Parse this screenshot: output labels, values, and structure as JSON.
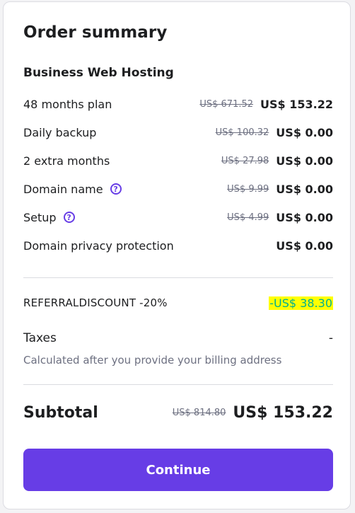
{
  "summary": {
    "title": "Order summary",
    "product": "Business Web Hosting",
    "items": [
      {
        "label": "48 months plan",
        "old_price": "US$ 671.52",
        "price": "US$ 153.22",
        "help": false
      },
      {
        "label": "Daily backup",
        "old_price": "US$ 100.32",
        "price": "US$ 0.00",
        "help": false
      },
      {
        "label": "2 extra months",
        "old_price": "US$ 27.98",
        "price": "US$ 0.00",
        "help": false
      },
      {
        "label": "Domain name",
        "old_price": "US$ 9.99",
        "price": "US$ 0.00",
        "help": true
      },
      {
        "label": "Setup",
        "old_price": "US$ 4.99",
        "price": "US$ 0.00",
        "help": true
      },
      {
        "label": "Domain privacy protection",
        "old_price": "",
        "price": "US$ 0.00",
        "help": false
      }
    ],
    "help_icon_glyph": "?",
    "discount": {
      "label": "REFERRALDISCOUNT -20%",
      "value": "-US$ 38.30"
    },
    "taxes": {
      "label": "Taxes",
      "value": "-",
      "note": "Calculated after you provide your billing address"
    },
    "subtotal": {
      "label": "Subtotal",
      "old_price": "US$ 814.80",
      "price": "US$ 153.22"
    },
    "continue_label": "Continue"
  },
  "colors": {
    "accent": "#673de6",
    "discount_text": "#00b090",
    "discount_highlight": "#ffff00"
  }
}
